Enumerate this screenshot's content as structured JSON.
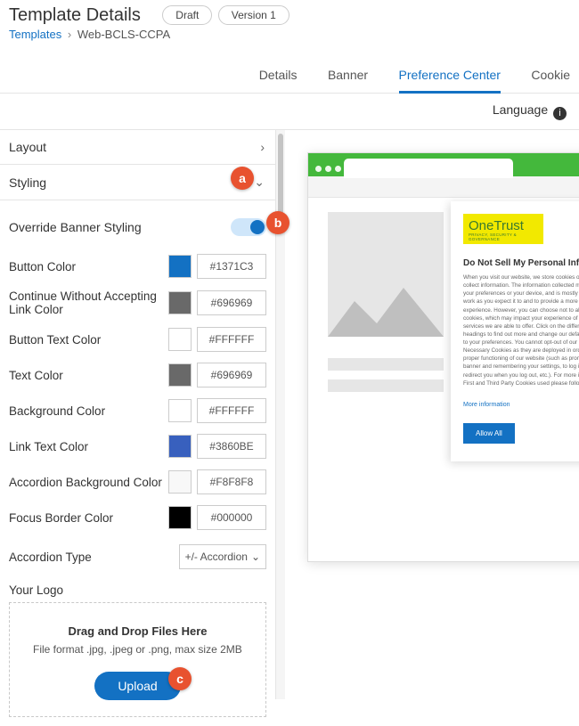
{
  "header": {
    "title": "Template Details",
    "pills": [
      "Draft",
      "Version 1"
    ],
    "breadcrumb": {
      "root": "Templates",
      "current": "Web-BCLS-CCPA"
    }
  },
  "tabs": [
    "Details",
    "Banner",
    "Preference Center",
    "Cookie"
  ],
  "active_tab": "Preference Center",
  "language_label": "Language",
  "sidebar": {
    "sections": {
      "layout": "Layout",
      "styling": "Styling"
    },
    "override_label": "Override Banner Styling",
    "override_on": true,
    "colors": [
      {
        "label": "Button Color",
        "hex": "#1371C3"
      },
      {
        "label": "Continue Without Accepting Link Color",
        "hex": "#696969"
      },
      {
        "label": "Button Text Color",
        "hex": "#FFFFFF"
      },
      {
        "label": "Text Color",
        "hex": "#696969"
      },
      {
        "label": "Background Color",
        "hex": "#FFFFFF"
      },
      {
        "label": "Link Text Color",
        "hex": "#3860BE"
      },
      {
        "label": "Accordion Background Color",
        "hex": "#F8F8F8"
      },
      {
        "label": "Focus Border Color",
        "hex": "#000000"
      }
    ],
    "accordion_type": {
      "label": "Accordion Type",
      "value": "+/- Accordion"
    },
    "logo": {
      "label": "Your Logo",
      "drop_title": "Drag and Drop Files Here",
      "drop_sub": "File format .jpg, .jpeg or .png, max size 2MB",
      "upload": "Upload"
    }
  },
  "preview": {
    "brand": "OneTrust",
    "brand_tag": "PRIVACY, SECURITY & GOVERNANCE",
    "modal_title": "Do Not Sell My Personal Information",
    "modal_body": "When you visit our website, we store cookies on your browser to collect information. The information collected might relate to you, your preferences or your device, and is mostly used to make the site work as you expect it to and to provide a more personalized web experience. However, you can choose not to allow certain types of cookies, which may impact your experience of the site and the services we are able to offer. Click on the different category headings to find out more and change our default settings according to your preferences. You cannot opt-out of our First Party Strictly Necessary Cookies as they are deployed in order to ensure the proper functioning of our website (such as prompting the cookie banner and remembering your settings, to log into your account, to redirect you when you log out, etc.). For more information about the First and Third Party Cookies used please follow this link.",
    "more_info": "More information",
    "allow_all": "Allow All"
  },
  "annotations": {
    "a": "a",
    "b": "b",
    "c": "c"
  }
}
